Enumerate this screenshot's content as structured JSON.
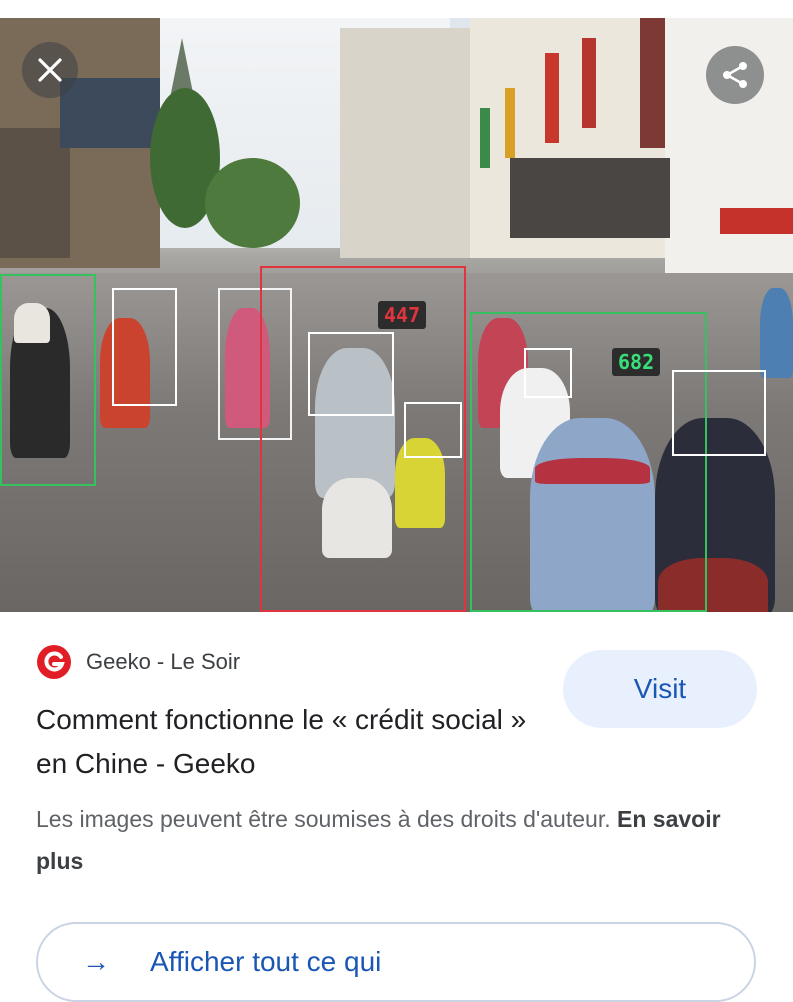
{
  "image": {
    "overlay_numbers": [
      "682",
      "447"
    ],
    "close_button": "close-icon",
    "share_button": "share-icon",
    "colors": {
      "box_red": "#e0343f",
      "box_green": "#35c25e",
      "face_box": "#ffffff"
    }
  },
  "source": {
    "name": "Geeko - Le Soir",
    "logo_color": "#e11d26"
  },
  "title": "Comment fonctionne le « crédit social » en Chine - Geeko",
  "visit_label": "Visit",
  "rights": {
    "text": "Les images peuvent être soumises à des droits d'auteur.",
    "link": "En savoir plus"
  },
  "bottom_button": {
    "label": "Afficher tout ce qui"
  }
}
